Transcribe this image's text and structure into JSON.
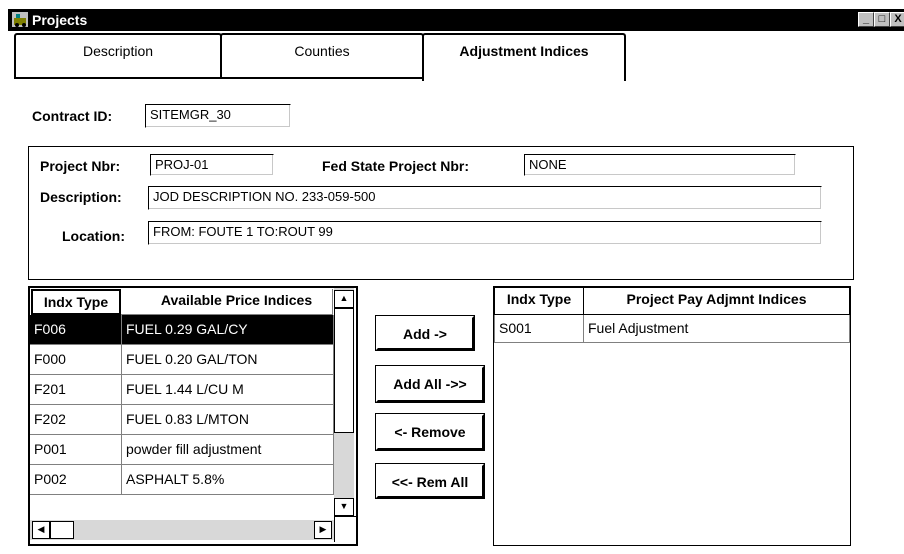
{
  "window": {
    "title": "Projects",
    "buttons": [
      "_",
      "□",
      "X"
    ]
  },
  "tabs": [
    {
      "label": "Description",
      "active": false
    },
    {
      "label": "Counties",
      "active": false
    },
    {
      "label": "Adjustment Indices",
      "active": true
    }
  ],
  "contract": {
    "label": "Contract ID:",
    "value": "SITEMGR_30"
  },
  "project": {
    "nbr_label": "Project Nbr:",
    "nbr_value": "PROJ-01",
    "fed_label": "Fed State Project Nbr:",
    "fed_value": "NONE",
    "desc_label": "Description:",
    "desc_value": "JOD DESCRIPTION NO. 233-059-500",
    "loc_label": "Location:",
    "loc_value": "FROM:  FOUTE 1 TO:ROUT 99"
  },
  "available": {
    "headers": [
      "Indx Type",
      "Available Price Indices"
    ],
    "rows": [
      [
        "F006",
        "FUEL 0.29 GAL/CY"
      ],
      [
        "F000",
        "FUEL 0.20 GAL/TON"
      ],
      [
        "F201",
        "FUEL 1.44 L/CU M"
      ],
      [
        "F202",
        "FUEL 0.83 L/MTON"
      ],
      [
        "P001",
        "powder fill adjustment"
      ],
      [
        "P002",
        "ASPHALT 5.8%"
      ]
    ]
  },
  "buttons": {
    "add": "Add ->",
    "add_all": "Add All ->>",
    "remove": "<- Remove",
    "rem_all": "<<- Rem All"
  },
  "project_indices": {
    "headers": [
      "Indx Type",
      "Project Pay Adjmnt Indices"
    ],
    "rows": [
      [
        "S001",
        "Fuel Adjustment"
      ]
    ]
  },
  "colors": {
    "selection": "#000000",
    "window": "#ffffff"
  }
}
